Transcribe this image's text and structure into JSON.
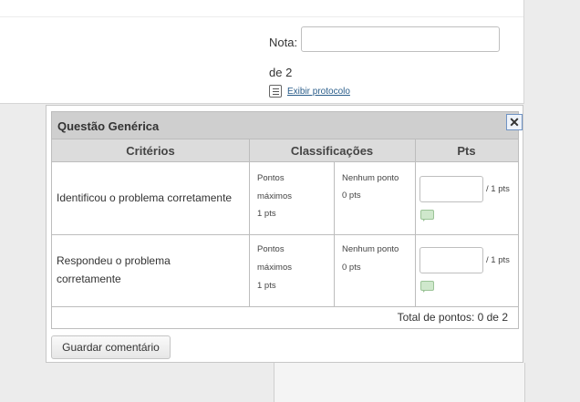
{
  "grade": {
    "label": "Nota:",
    "value": "",
    "out_of": "de 2",
    "protocol_link": "Exibir protocolo"
  },
  "rubric": {
    "title": "Questão Genérica",
    "close_symbol": "✕",
    "columns": [
      "Critérios",
      "Classificações",
      "Pts"
    ],
    "rows": [
      {
        "criterion_line1": "Identificou o problema corretamente",
        "criterion_line2": "",
        "max_label_line1": "Pontos",
        "max_label_line2": "máximos",
        "max_points": "1 pts",
        "none_label": "Nenhum ponto",
        "none_points": "0 pts",
        "input_value": "",
        "out_of": "/ 1 pts"
      },
      {
        "criterion_line1": "Respondeu o problema",
        "criterion_line2": "corretamente",
        "max_label_line1": "Pontos",
        "max_label_line2": "máximos",
        "max_points": "1 pts",
        "none_label": "Nenhum ponto",
        "none_points": "0 pts",
        "input_value": "",
        "out_of": "/ 1 pts"
      }
    ],
    "total": "Total de pontos: 0 de 2",
    "save_button": "Guardar comentário"
  },
  "icons": {
    "protocol": "list-document-icon",
    "comment": "speech-bubble-icon",
    "close": "close-icon"
  },
  "colors": {
    "header_bg": "#cfcfcf",
    "link": "#2a5d8a",
    "comment_icon": "#cfe8cc"
  }
}
